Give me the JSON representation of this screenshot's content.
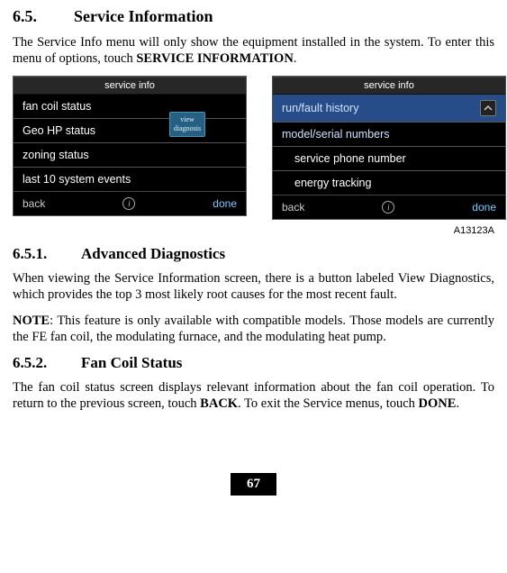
{
  "section": {
    "num": "6.5.",
    "title": "Service Information"
  },
  "intro": {
    "p1a": "The Service Info menu will only show the equipment installed in the system. To enter this menu of options, touch ",
    "p1b": "SERVICE INFORMATION",
    "p1c": "."
  },
  "screens": {
    "left": {
      "title": "service info",
      "items": [
        "fan coil status",
        "Geo HP status",
        "zoning status",
        "last 10 system events"
      ],
      "viewdiag_l1": "view",
      "viewdiag_l2": "diagnosis",
      "back": "back",
      "done": "done"
    },
    "right": {
      "title": "service info",
      "items": [
        "run/fault history",
        "model/serial numbers",
        "service phone number",
        "energy tracking"
      ],
      "back": "back",
      "done": "done"
    }
  },
  "figlabel": "A13123A",
  "sub1": {
    "num": "6.5.1.",
    "title": "Advanced Diagnostics",
    "p1": "When viewing the Service Information screen, there is a button labeled View Diagnostics, which provides the top 3 most likely root causes for the most recent fault.",
    "noteLabel": "NOTE",
    "noteRest": ":  This feature is only available with compatible models.  Those models are currently the FE fan coil, the modulating furnace, and the modulating heat pump."
  },
  "sub2": {
    "num": "6.5.2.",
    "title": "Fan Coil Status",
    "p1a": "The fan coil status screen displays relevant information about the fan coil operation. To return to the previous screen, touch ",
    "p1b": "BACK",
    "p1c": ". To exit the Service menus, touch ",
    "p1d": "DONE",
    "p1e": "."
  },
  "pagenum": "67"
}
